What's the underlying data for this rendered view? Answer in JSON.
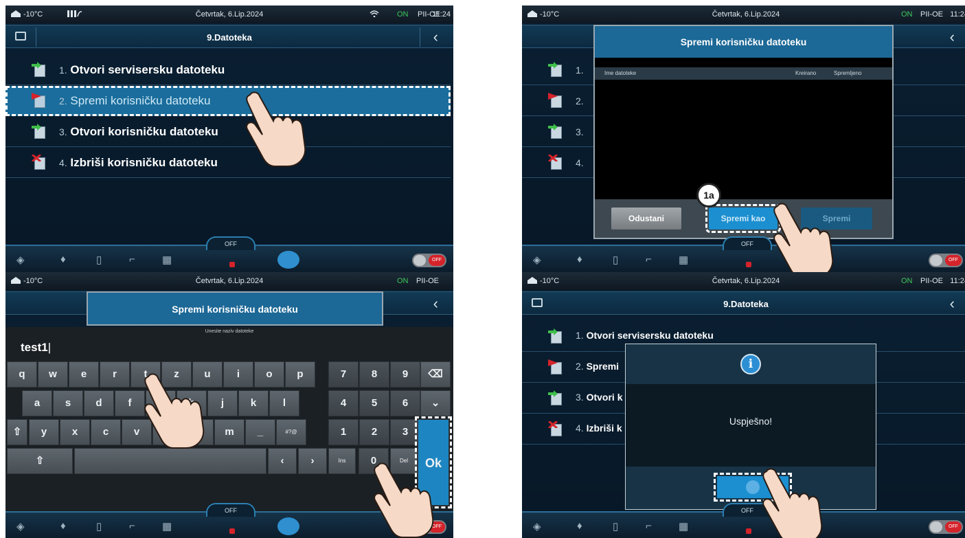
{
  "status": {
    "temperature": "-10°C",
    "date": "Četvrtak, 6.Lip.2024",
    "on_label": "ON",
    "mode": "PII-OE",
    "time": "11:24"
  },
  "menu": {
    "title": "9.Datoteka",
    "items": [
      {
        "num": "1.",
        "label": "Otvori servisersku datoteku",
        "icon": "file-open-icon"
      },
      {
        "num": "2.",
        "label": "Spremi korisničku datoteku",
        "icon": "file-save-icon"
      },
      {
        "num": "3.",
        "label": "Otvori korisničku datoteku",
        "icon": "file-open-icon"
      },
      {
        "num": "4.",
        "label": "Izbriši korisničku datoteku",
        "icon": "file-delete-icon"
      }
    ],
    "short_items": [
      "1.",
      "2.",
      "3.",
      "4."
    ],
    "partial_labels": [
      "Otvori servisersku datoteku",
      "Spremi",
      "Otvori k",
      "Izbriši k"
    ]
  },
  "footer": {
    "off_label": "OFF",
    "toggle_label": "OFF"
  },
  "save_dialog": {
    "title": "Spremi korisničku datoteku",
    "col_name": "Ime datoteke",
    "col_created": "Kreirano",
    "col_saved": "Spremljeno",
    "cancel": "Odustani",
    "save_as": "Spremi kao",
    "save": "Spremi",
    "step_badge": "1a"
  },
  "keyboard": {
    "title": "Spremi korisničku datoteku",
    "hint": "Unesite naziv datoteke",
    "input_value": "test1",
    "row1": [
      "q",
      "w",
      "e",
      "r",
      "t",
      "z",
      "u",
      "i",
      "o",
      "p"
    ],
    "row2": [
      "a",
      "s",
      "d",
      "f",
      "g",
      "h",
      "j",
      "k",
      "l"
    ],
    "row3": [
      "y",
      "x",
      "c",
      "v",
      "b",
      "n",
      "m",
      "_",
      "#?@"
    ],
    "numpad": [
      "7",
      "8",
      "9",
      "4",
      "5",
      "6",
      "1",
      "2",
      "3",
      "0"
    ],
    "ins": "Ins",
    "del": "Del",
    "ok": "Ok"
  },
  "info_dialog": {
    "message": "Uspješno!"
  },
  "colors": {
    "accent": "#1b8fd0",
    "header": "#1c6896",
    "danger": "#d4232a",
    "on": "#3cc95a"
  }
}
